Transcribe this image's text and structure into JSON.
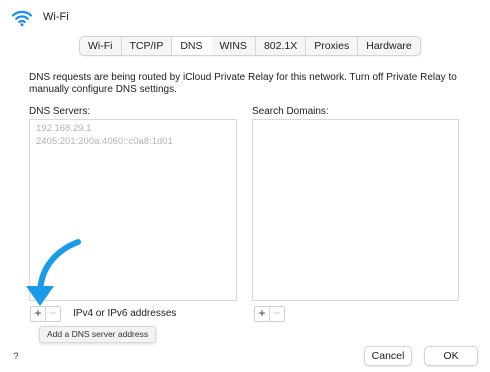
{
  "window": {
    "title": "Wi-Fi",
    "icon": "wifi-icon"
  },
  "tabs": [
    {
      "label": "Wi-Fi",
      "active": false
    },
    {
      "label": "TCP/IP",
      "active": false
    },
    {
      "label": "DNS",
      "active": true
    },
    {
      "label": "WINS",
      "active": false
    },
    {
      "label": "802.1X",
      "active": false
    },
    {
      "label": "Proxies",
      "active": false
    },
    {
      "label": "Hardware",
      "active": false
    }
  ],
  "dns": {
    "notice": "DNS requests are being routed by iCloud Private Relay for this network. Turn off Private Relay to manually configure DNS settings.",
    "servers_label": "DNS Servers:",
    "servers": [
      "192.168.29.1",
      "2405:201:200a:4060::c0a8:1d01"
    ],
    "add_label": "+",
    "remove_label": "−",
    "hint": "IPv4 or IPv6 addresses",
    "tooltip": "Add a DNS server address"
  },
  "search": {
    "label": "Search Domains:",
    "add_label": "+",
    "remove_label": "−"
  },
  "footer": {
    "help_label": "?",
    "cancel_label": "Cancel",
    "ok_label": "OK"
  },
  "colors": {
    "arrow": "#1a9be9",
    "wifi_icon": "#1a8cff",
    "disabled_text": "#b3b3b3"
  }
}
